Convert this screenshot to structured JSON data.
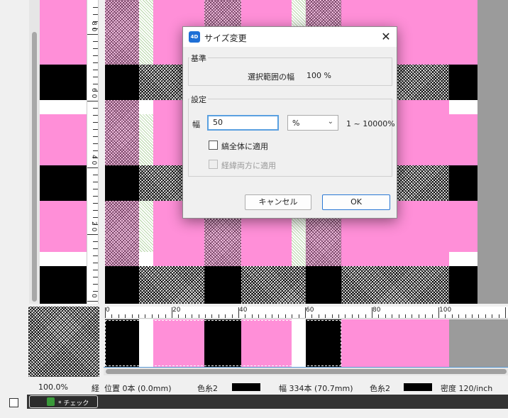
{
  "dialog": {
    "app_icon_text": "4D",
    "title": "サイズ変更",
    "close_glyph": "✕",
    "basis_group": "基準",
    "basis_label": "選択範囲の幅",
    "basis_value": "100 %",
    "settings_group": "設定",
    "width_label": "幅",
    "width_value": "50",
    "unit_selected": "%",
    "unit_chevron": "⌄",
    "range_text": "1 ~ 10000%",
    "apply_whole_label": "縞全体に適用",
    "apply_whole_checked": false,
    "apply_both_label": "経緯両方に適用",
    "apply_both_enabled": false,
    "cancel_label": "キャンセル",
    "ok_label": "OK"
  },
  "vertical_ruler": {
    "labels": [
      "8\n0",
      "6\n0",
      "4\n0",
      "2\n0",
      "0"
    ]
  },
  "horizontal_ruler": {
    "labels": [
      "0",
      "20",
      "40",
      "60",
      "80",
      "100"
    ]
  },
  "status": {
    "zoom": "100.0%",
    "axis": "経",
    "position": "位置 0本 (0.0mm)",
    "color_left": "色糸2",
    "width_info": "幅 334本 (70.7mm)",
    "color_right": "色糸2",
    "density": "密度 120/inch"
  },
  "tab": {
    "label": "* チェック"
  },
  "colors": {
    "pink": "#ff8fd8",
    "black": "#000000",
    "gray": "#9b9b9b",
    "accent": "#2a78d4"
  },
  "icons": {
    "close": "close-icon",
    "chevron": "chevron-down-icon",
    "app": "app-4d-icon",
    "tab_doc": "document-icon"
  }
}
